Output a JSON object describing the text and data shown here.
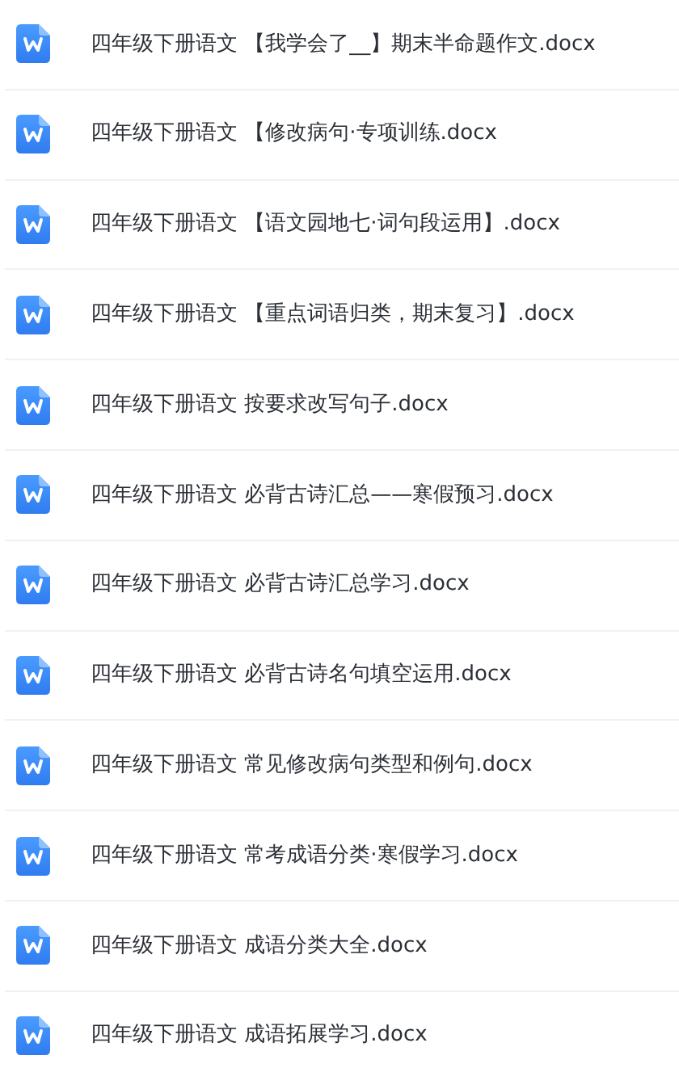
{
  "files": [
    {
      "name": "四年级下册语文 【我学会了__】期末半命题作文.docx"
    },
    {
      "name": "四年级下册语文 【修改病句·专项训练.docx"
    },
    {
      "name": "四年级下册语文 【语文园地七·词句段运用】.docx"
    },
    {
      "name": "四年级下册语文 【重点词语归类，期末复习】.docx"
    },
    {
      "name": "四年级下册语文 按要求改写句子.docx"
    },
    {
      "name": "四年级下册语文 必背古诗汇总——寒假预习.docx"
    },
    {
      "name": "四年级下册语文 必背古诗汇总学习.docx"
    },
    {
      "name": "四年级下册语文 必背古诗名句填空运用.docx"
    },
    {
      "name": "四年级下册语文 常见修改病句类型和例句.docx"
    },
    {
      "name": "四年级下册语文 常考成语分类·寒假学习.docx"
    },
    {
      "name": "四年级下册语文 成语分类大全.docx"
    },
    {
      "name": "四年级下册语文 成语拓展学习.docx"
    }
  ]
}
